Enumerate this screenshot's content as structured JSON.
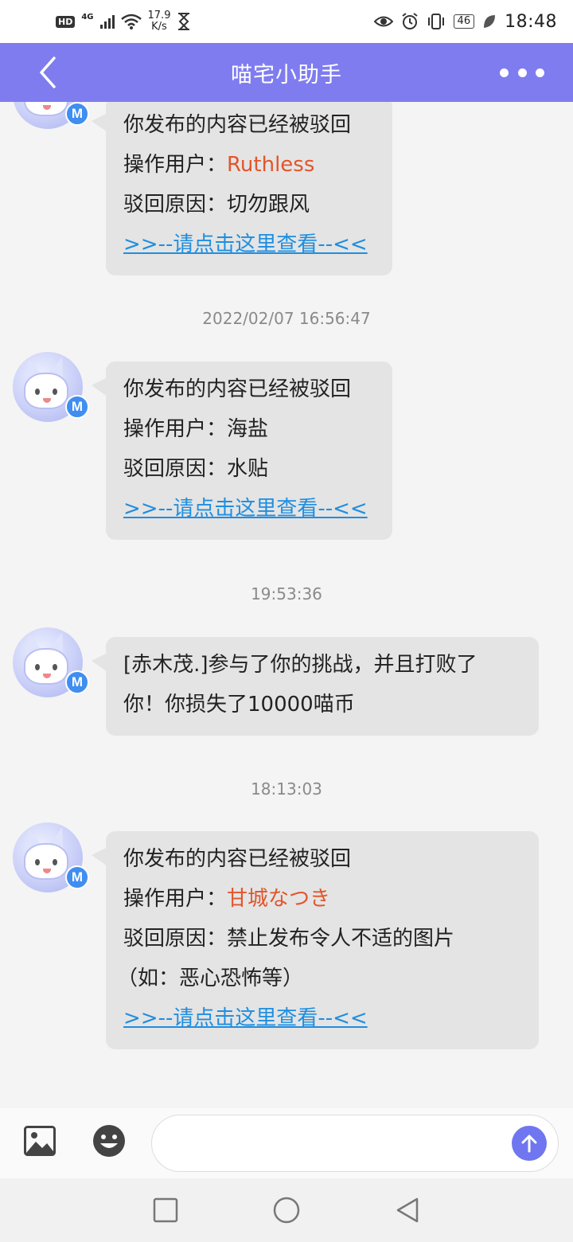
{
  "status_bar": {
    "hd": "HD",
    "network": "4G",
    "speed_value": "17.9",
    "speed_unit": "K/s",
    "battery": "46",
    "time": "18:48"
  },
  "header": {
    "title": "喵宅小助手",
    "back_icon": "chevron-left-icon",
    "more_icon": "more-dots-icon"
  },
  "avatar": {
    "badge": "M"
  },
  "messages": [
    {
      "line1": "你发布的内容已经被驳回",
      "user_label": "操作用户：",
      "user": "Ruthless",
      "reason_label": "驳回原因：",
      "reason": "切勿跟风",
      "link": ">>--请点击这里查看--<<"
    },
    {
      "timestamp": "2022/02/07 16:56:47",
      "line1": "你发布的内容已经被驳回",
      "user_label": "操作用户：",
      "user": "海盐",
      "reason_label": "驳回原因：",
      "reason": "水贴",
      "link": ">>--请点击这里查看--<<"
    },
    {
      "timestamp": "19:53:36",
      "line1": "[赤木茂.]参与了你的挑战，并且打败了",
      "line2": "你！你损失了10000喵币"
    },
    {
      "timestamp": "18:13:03",
      "line1": "你发布的内容已经被驳回",
      "user_label": "操作用户：",
      "user": "甘城なつき",
      "reason_label": "驳回原因：",
      "reason": "禁止发布令人不适的图片",
      "reason_cont": "（如：恶心恐怖等）",
      "link": ">>--请点击这里查看--<<"
    }
  ],
  "input_bar": {
    "placeholder": "",
    "image_icon": "image-icon",
    "emoji_icon": "emoji-icon",
    "send_icon": "send-arrow-up-icon"
  },
  "colors": {
    "header_bg": "#7f7cf0",
    "bubble_bg": "#e4e4e4",
    "highlight": "#e2552a",
    "link": "#1e8ee0",
    "send_bg": "#6f76ef"
  }
}
